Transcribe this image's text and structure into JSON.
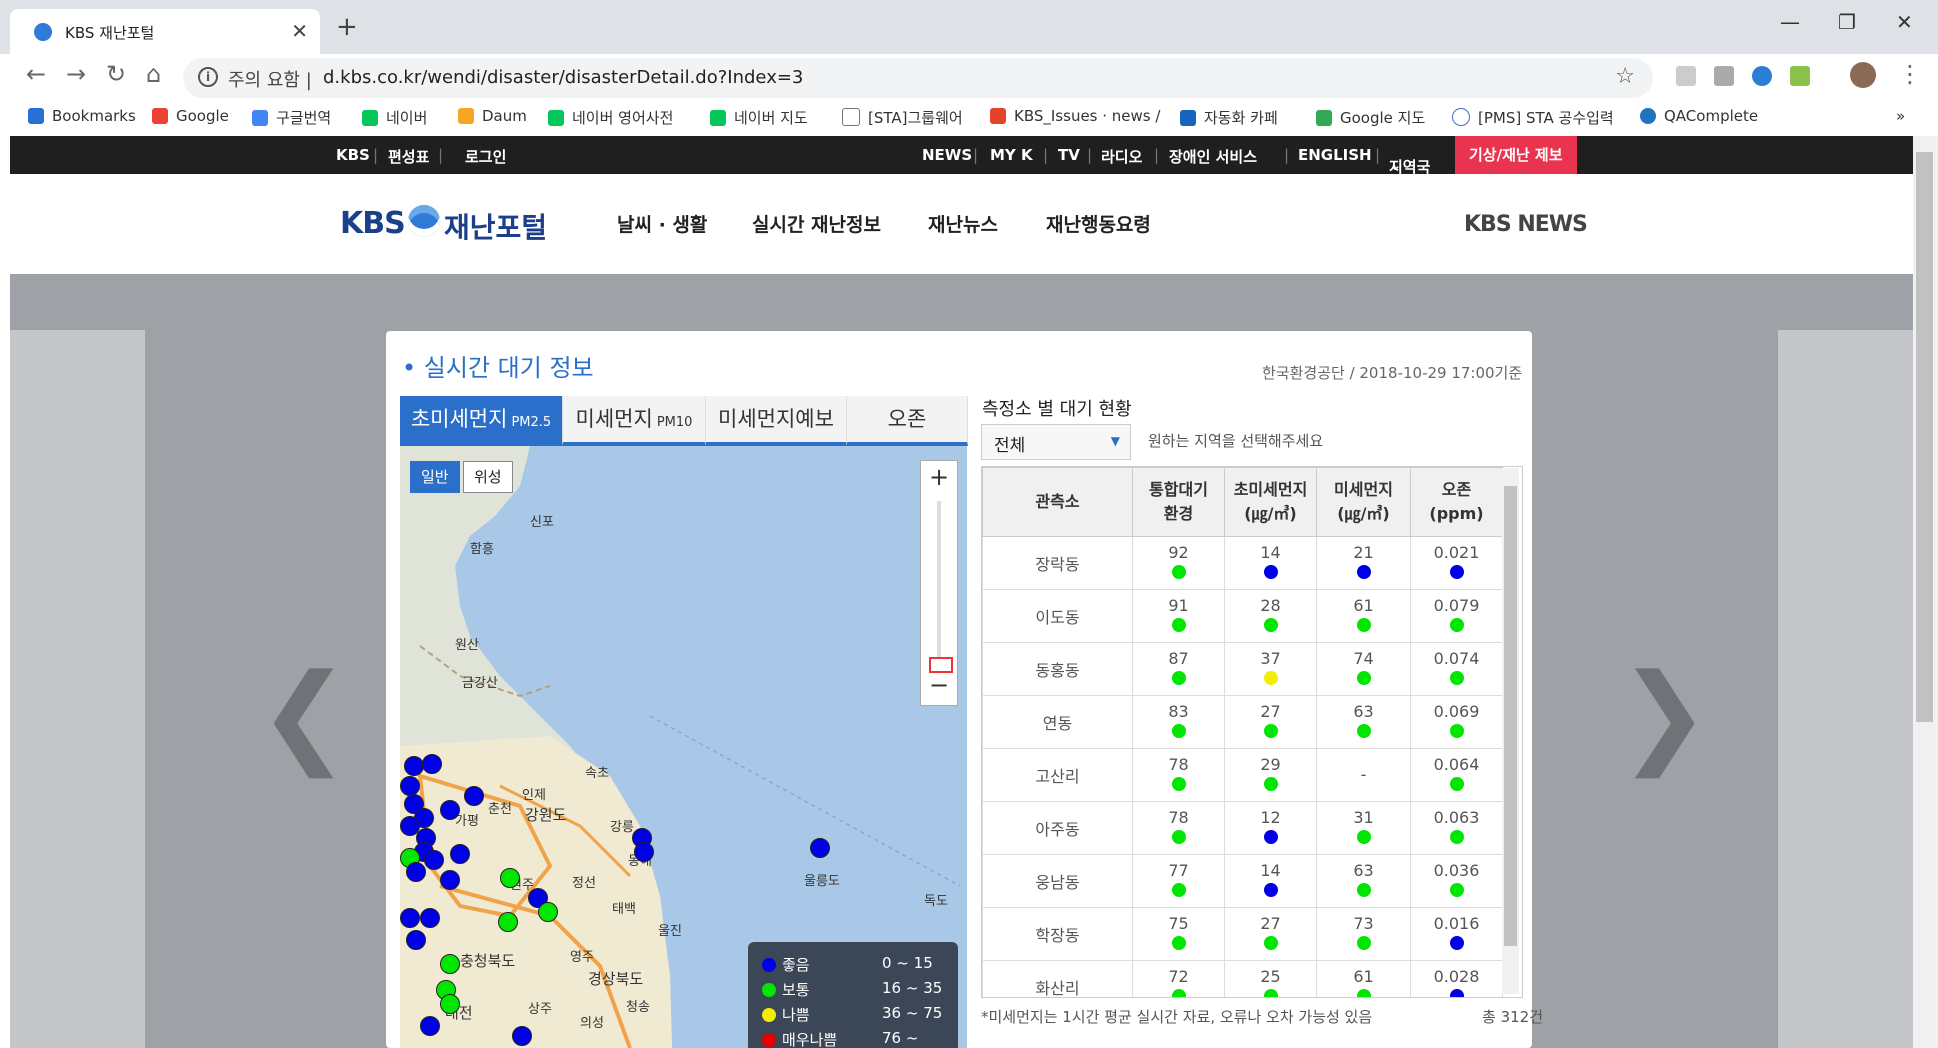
{
  "browser": {
    "tab_title": "KBS 재난포털",
    "security_label": "주의 요함",
    "url": "d.kbs.co.kr/wendi/disaster/disasterDetail.do?Index=3",
    "bookmarks": [
      "Bookmarks",
      "Google",
      "구글번역",
      "네이버",
      "Daum",
      "네이버 영어사전",
      "네이버 지도",
      "[STA]그룹웨어",
      "KBS_Issues · news /",
      "자동화 카페",
      "Google 지도",
      "[PMS] STA 공수입력",
      "QAComplete"
    ],
    "bookmarks_more": "»"
  },
  "gnb": {
    "left": [
      "KBS",
      "편성표",
      "로그인"
    ],
    "right": [
      "NEWS",
      "MY K",
      "TV",
      "라디오",
      "장애인 서비스",
      "ENGLISH",
      "지역국"
    ],
    "report": "기상/재난 제보"
  },
  "header": {
    "logo_kbs": "KBS",
    "logo_text": "재난포털",
    "menu": [
      "날씨 · 생활",
      "실시간 재난정보",
      "재난뉴스",
      "재난행동요령"
    ],
    "kbs_news": "KBS NEWS"
  },
  "panel": {
    "title": "실시간 대기 정보",
    "source": "한국환경공단 / 2018-10-29 17:00기준",
    "tabs": [
      {
        "label": "초미세먼지",
        "sub": "PM2.5"
      },
      {
        "label": "미세먼지",
        "sub": "PM10"
      },
      {
        "label": "미세먼지예보",
        "sub": ""
      },
      {
        "label": "오존",
        "sub": ""
      }
    ],
    "map": {
      "type_normal": "일반",
      "type_satellite": "위성",
      "zoom_in": "+",
      "zoom_out": "−",
      "cities": [
        "신포",
        "함흥",
        "원산",
        "금강산",
        "속초",
        "인제",
        "강원도",
        "춘천",
        "가평",
        "강릉",
        "동해",
        "울릉도",
        "독도",
        "원주",
        "정선",
        "태백",
        "울진",
        "영주",
        "충청북도",
        "경상북도",
        "청송",
        "상주",
        "의성",
        "대전"
      ],
      "legend": [
        {
          "label": "좋음",
          "range": "0 ~ 15",
          "color": "#0000e6"
        },
        {
          "label": "보통",
          "range": "16 ~ 35",
          "color": "#00e600"
        },
        {
          "label": "나쁨",
          "range": "36 ~ 75",
          "color": "#f2ee00"
        },
        {
          "label": "매우나쁨",
          "range": "76 ~",
          "color": "#e60000"
        }
      ]
    },
    "stations": {
      "title": "측정소 별 대기 현황",
      "region_selected": "전체",
      "region_hint": "원하는 지역을 선택해주세요",
      "columns": [
        "관측소",
        "통합대기\n환경",
        "초미세먼지\n(㎍/㎥)",
        "미세먼지\n(㎍/㎥)",
        "오존\n(ppm)"
      ],
      "rows": [
        {
          "name": "장락동",
          "khai": "92",
          "pm25": "14",
          "pm10": "21",
          "o3": "0.021",
          "c": [
            "green",
            "blue",
            "blue",
            "blue"
          ]
        },
        {
          "name": "이도동",
          "khai": "91",
          "pm25": "28",
          "pm10": "61",
          "o3": "0.079",
          "c": [
            "green",
            "green",
            "green",
            "green"
          ]
        },
        {
          "name": "동홍동",
          "khai": "87",
          "pm25": "37",
          "pm10": "74",
          "o3": "0.074",
          "c": [
            "green",
            "yellow",
            "green",
            "green"
          ]
        },
        {
          "name": "연동",
          "khai": "83",
          "pm25": "27",
          "pm10": "63",
          "o3": "0.069",
          "c": [
            "green",
            "green",
            "green",
            "green"
          ]
        },
        {
          "name": "고산리",
          "khai": "78",
          "pm25": "29",
          "pm10": "-",
          "o3": "0.064",
          "c": [
            "green",
            "green",
            "",
            "green"
          ]
        },
        {
          "name": "아주동",
          "khai": "78",
          "pm25": "12",
          "pm10": "31",
          "o3": "0.063",
          "c": [
            "green",
            "blue",
            "green",
            "green"
          ]
        },
        {
          "name": "웅남동",
          "khai": "77",
          "pm25": "14",
          "pm10": "63",
          "o3": "0.036",
          "c": [
            "green",
            "blue",
            "green",
            "green"
          ]
        },
        {
          "name": "학장동",
          "khai": "75",
          "pm25": "27",
          "pm10": "73",
          "o3": "0.016",
          "c": [
            "green",
            "green",
            "green",
            "blue"
          ]
        },
        {
          "name": "화산리",
          "khai": "72",
          "pm25": "25",
          "pm10": "61",
          "o3": "0.028",
          "c": [
            "green",
            "green",
            "green",
            "blue"
          ]
        }
      ],
      "note": "*미세먼지는 1시간 평균 실시간 자료, 오류나 오차 가능성 있음",
      "total": "총 312건"
    }
  },
  "colors": {
    "blue": "#0000e6",
    "green": "#00e600",
    "yellow": "#f2ee00",
    "red": "#e60000",
    "accent": "#2a6fc9",
    "report": "#e8344e"
  }
}
